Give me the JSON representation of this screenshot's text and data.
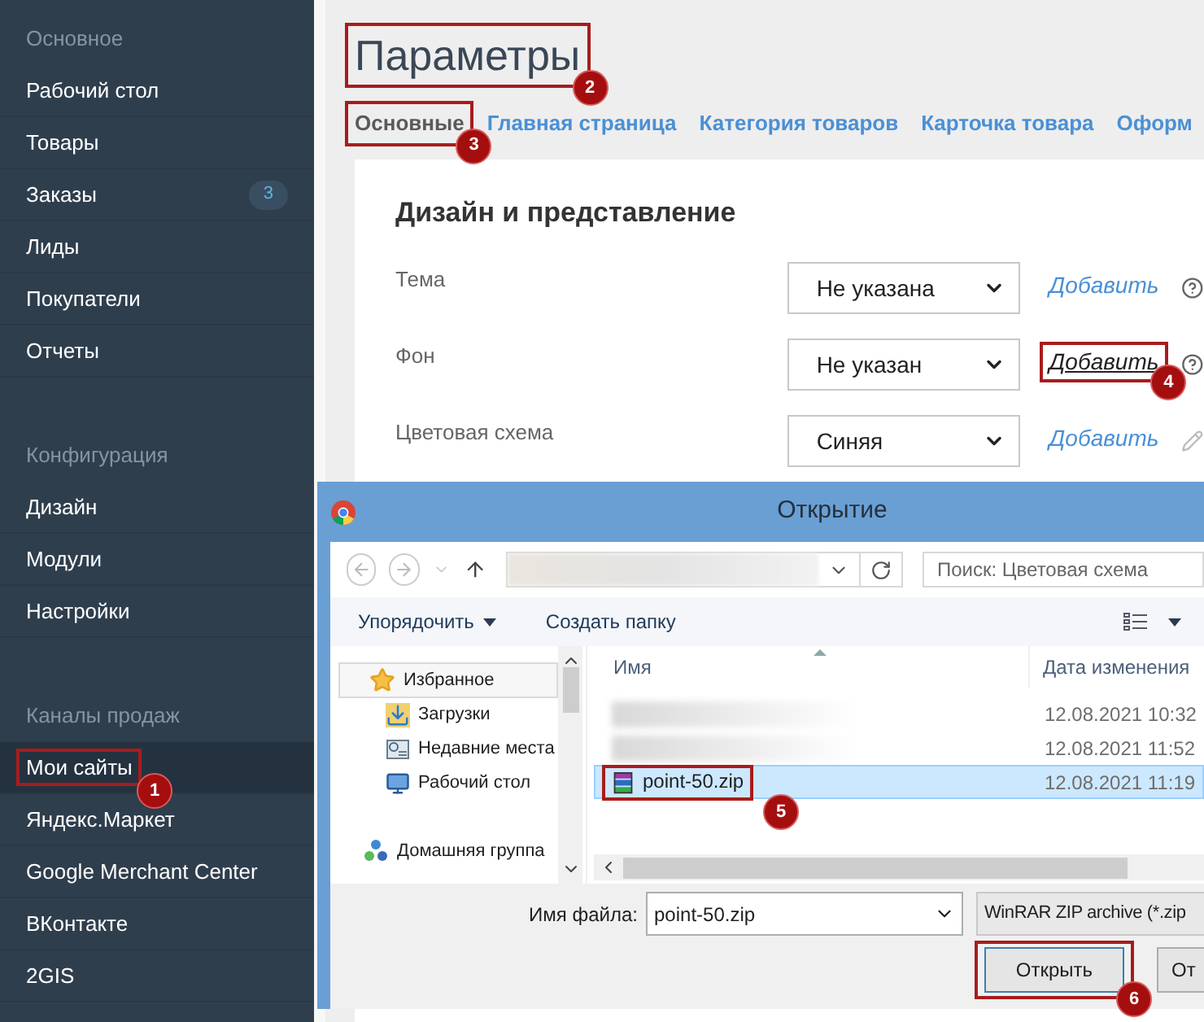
{
  "sidebar": {
    "sections": [
      {
        "title": "Основное",
        "items": [
          {
            "label": "Рабочий стол",
            "selected": false
          },
          {
            "label": "Товары",
            "selected": false
          },
          {
            "label": "Заказы",
            "selected": false,
            "badge": "3"
          },
          {
            "label": "Лиды",
            "selected": false
          },
          {
            "label": "Покупатели",
            "selected": false
          },
          {
            "label": "Отчеты",
            "selected": false
          }
        ]
      },
      {
        "title": "Конфигурация",
        "items": [
          {
            "label": "Дизайн",
            "selected": false
          },
          {
            "label": "Модули",
            "selected": false
          },
          {
            "label": "Настройки",
            "selected": false
          }
        ]
      },
      {
        "title": "Каналы продаж",
        "items": [
          {
            "label": "Мои сайты",
            "selected": true,
            "marker": "1"
          },
          {
            "label": "Яндекс.Маркет",
            "selected": false
          },
          {
            "label": "Google Merchant Center",
            "selected": false
          },
          {
            "label": "ВКонтакте",
            "selected": false
          },
          {
            "label": "2GIS",
            "selected": false
          }
        ]
      }
    ]
  },
  "page": {
    "title": "Параметры",
    "title_marker": "2",
    "tabs": [
      {
        "label": "Основные",
        "selected": true,
        "marker": "3"
      },
      {
        "label": "Главная страница",
        "selected": false
      },
      {
        "label": "Категория товаров",
        "selected": false
      },
      {
        "label": "Карточка товара",
        "selected": false
      },
      {
        "label": "Оформ",
        "selected": false
      }
    ]
  },
  "card": {
    "heading": "Дизайн и представление",
    "rows": [
      {
        "label": "Тема",
        "value": "Не указана",
        "link": "Добавить",
        "kind": "help"
      },
      {
        "label": "Фон",
        "value": "Не указан",
        "link": "Добавить",
        "kind": "help",
        "marker": "4"
      },
      {
        "label": "Цветовая схема",
        "value": "Синяя",
        "link": "Добавить",
        "kind": "edit"
      }
    ]
  },
  "dialog": {
    "title": "Открытие",
    "search_placeholder": "Поиск: Цветовая схема",
    "toolbar": [
      {
        "label": "Упорядочить",
        "kind": "menu"
      },
      {
        "label": "Создать папку",
        "kind": "button"
      }
    ],
    "nav": [
      {
        "label": "Избранное",
        "kind": "favorites",
        "selected": true,
        "children": [
          {
            "label": "Загрузки",
            "kind": "downloads",
            "selected": false
          },
          {
            "label": "Недавние места",
            "kind": "recent",
            "selected": false
          },
          {
            "label": "Рабочий стол",
            "kind": "desktop",
            "selected": false
          }
        ]
      },
      {
        "label": "Домашняя группа",
        "kind": "homegroup",
        "selected": false
      }
    ],
    "columns": [
      "Имя",
      "Дата изменения"
    ],
    "files": [
      {
        "kind": "blurred",
        "date": "12.08.2021 10:32",
        "selected": false
      },
      {
        "kind": "blurred",
        "date": "12.08.2021 11:52",
        "selected": false
      },
      {
        "kind": "archive",
        "name": "point-50.zip",
        "date": "12.08.2021 11:19",
        "selected": true,
        "marker": "5"
      }
    ],
    "filename_label": "Имя файла:",
    "filename": "point-50.zip",
    "file_type": "WinRAR ZIP archive (*.zip",
    "buttons": [
      {
        "label": "Открыть",
        "default": true,
        "marker": "6"
      },
      {
        "label": "От",
        "default": false
      }
    ]
  }
}
